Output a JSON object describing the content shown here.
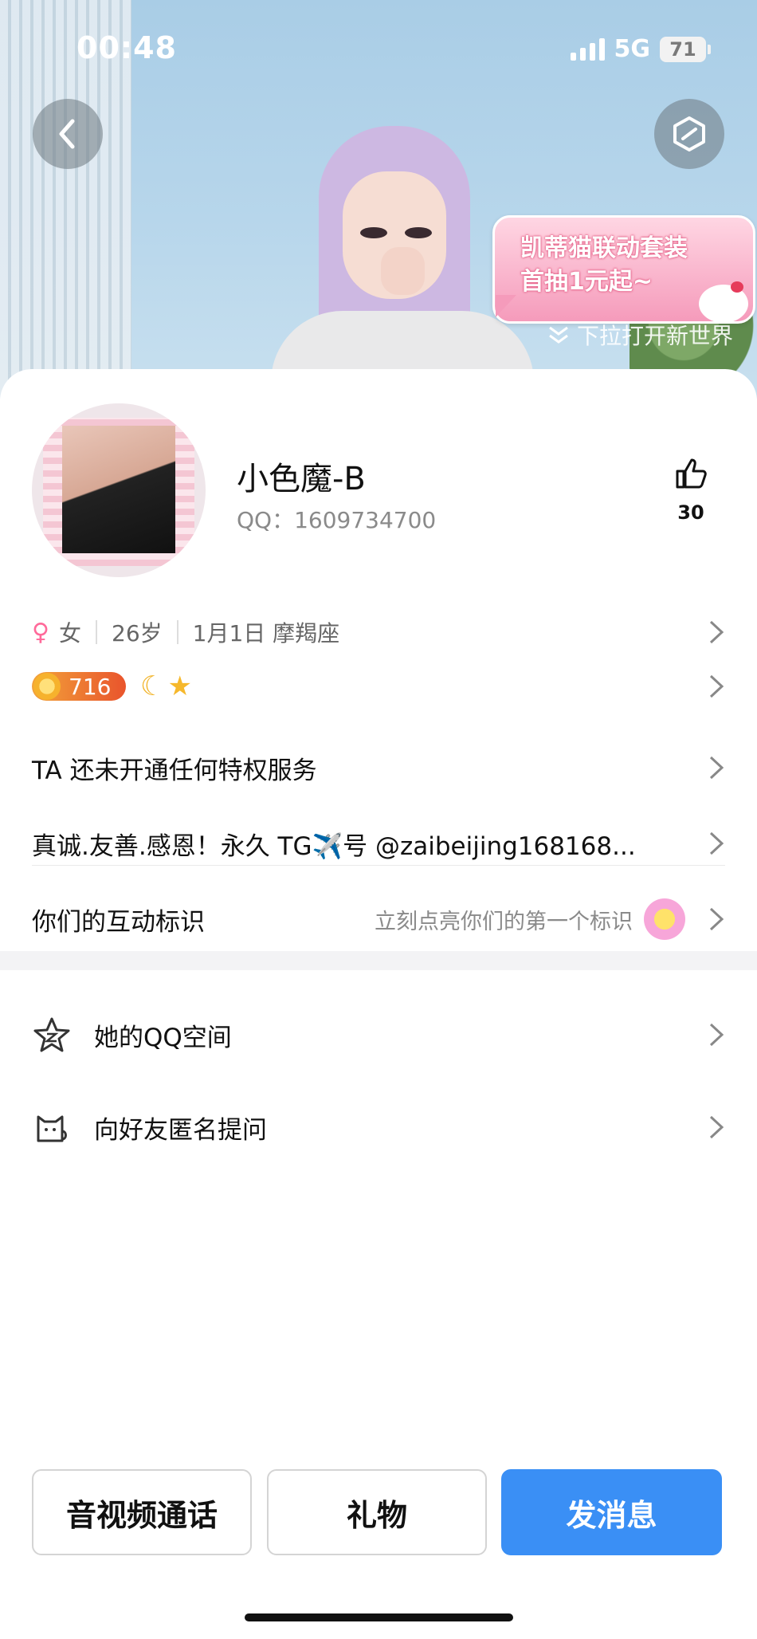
{
  "status_bar": {
    "time": "00:48",
    "network": "5G",
    "battery": "71"
  },
  "hero": {
    "promo_line1": "凯蒂猫联动套装",
    "promo_line2": "首抽1元起~",
    "pull_hint": "下拉打开新世界"
  },
  "profile": {
    "name": "小色魔-B",
    "qq": "QQ：1609734700",
    "likes": "30",
    "gender": "女",
    "age": "26岁",
    "birthday_sign": "1月1日  摩羯座",
    "level": "716"
  },
  "rows": {
    "privilege": "TA 还未开通任何特权服务",
    "signature": "真诚.友善.感恩！永久 TG✈️号 @zaibeijing168168...",
    "interaction_label": "你们的互动标识",
    "interaction_hint": "立刻点亮你们的第一个标识",
    "qzone": "她的QQ空间",
    "anon_question": "向好友匿名提问"
  },
  "buttons": {
    "call": "音视频通话",
    "gift": "礼物",
    "message": "发消息"
  },
  "colors": {
    "accent": "#3a8ff5",
    "level_badge": "#e9542c",
    "female": "#ff6a9a"
  }
}
